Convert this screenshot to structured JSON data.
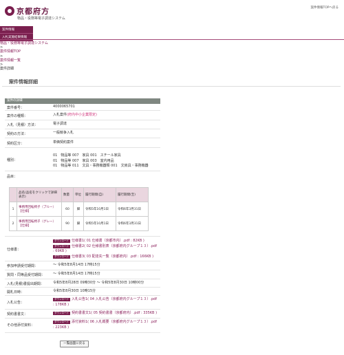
{
  "header": {
    "logo_text": "京都府方",
    "subtitle": "物品・役務等電子調達システム",
    "top_link": "案件情報TOPへ戻る"
  },
  "menu": [
    "案件情報",
    "入札実施結果情報"
  ],
  "breadcrumb": [
    "物品・役務等電子調達システム",
    "案件情報TOP",
    "案件情報一覧",
    "案件詳細"
  ],
  "page_title": "案件情報詳細",
  "section_title": "案件の詳細",
  "fields": {
    "case_number": {
      "label": "案件番号：",
      "value": "4000065701"
    },
    "case_type": {
      "label": "案件の種類：",
      "value": "入札案件",
      "value_link": "(府内中小企業限定)"
    },
    "contract_type": {
      "label": "入札（見積）方法：",
      "value": "電子調達"
    },
    "contract_method": {
      "label": "契約の方法：",
      "value": "一般競争入札"
    },
    "contract_category": {
      "label": "契約区分：",
      "value": "単価契約案件"
    },
    "type_label": "種別：",
    "types": [
      "01　物品等  007　家具  001　スチール家具",
      "01　物品等  007　家具  003　室内用品",
      "01　物品等  011　文具・事務機器類  001　文房具・事務機器"
    ],
    "items_label": "品目："
  },
  "items_table": {
    "headers": [
      "",
      "品名(品名をクリックで詳細表示)",
      "数量",
      "単位",
      "履行期間(自)",
      "履行期間(至)"
    ],
    "rows": [
      {
        "no": "1",
        "name": "事務用回転椅子（ブルー）",
        "tag": "【仕様】",
        "qty": "60",
        "unit": "脚",
        "from": "令和5年10月1日",
        "to": "令和6年3月31日"
      },
      {
        "no": "2",
        "name": "事務用回転椅子（グレー）",
        "tag": "【仕様】",
        "qty": "90",
        "unit": "脚",
        "from": "令和5年10月1日",
        "to": "令和6年3月31日"
      }
    ]
  },
  "spec": {
    "label": "仕様書：",
    "files": [
      {
        "badge": "ダウンロード",
        "line1": "仕様書1( 01 仕様書（京都市内）.pdf : 82KB )"
      },
      {
        "badge": "ダウンロード",
        "line1": "仕様書2( 02 仕様書別表（京都府内グループ１３）.pdf",
        "line2": " : 69KB )"
      },
      {
        "badge": "ダウンロード",
        "line1": "仕様書3( 03 配達先一覧（京都府内）.pdf : 166KB )"
      }
    ]
  },
  "dates": [
    {
      "label": "参加申請受付期間：",
      "value": "～ 令和5年8月14日 17時15分"
    },
    {
      "label": "質問・同等品受付期間：",
      "value": "～ 令和5年8月14日 17時15分"
    },
    {
      "label": "入札(見積)書提出期間：",
      "value": "令和5年8月28日 09時30分 ～ 令和5年8月30日 10時00分"
    },
    {
      "label": "開札日時：",
      "value": "令和5年8月30日 10時15分"
    }
  ],
  "notice": {
    "label": "入札公告：",
    "badge": "ダウンロード",
    "line1": "入札公告1( 04 入札公告（京都府内グループ１３）.pdf",
    "line2": " : 178KB )"
  },
  "contract": {
    "label": "契約書書文：",
    "badge": "ダウンロード",
    "line1": "契約書書文1( 05 契約書書（京都府内）.pdf : 335KB )"
  },
  "other": {
    "label": "その他添付資料：",
    "badge": "ダウンロード",
    "line1": "添付資料1( 06 入札概要（京都府内グループ１３）.pdf",
    "line2": " : 223KB )"
  },
  "back_button": "一覧画面に戻る"
}
